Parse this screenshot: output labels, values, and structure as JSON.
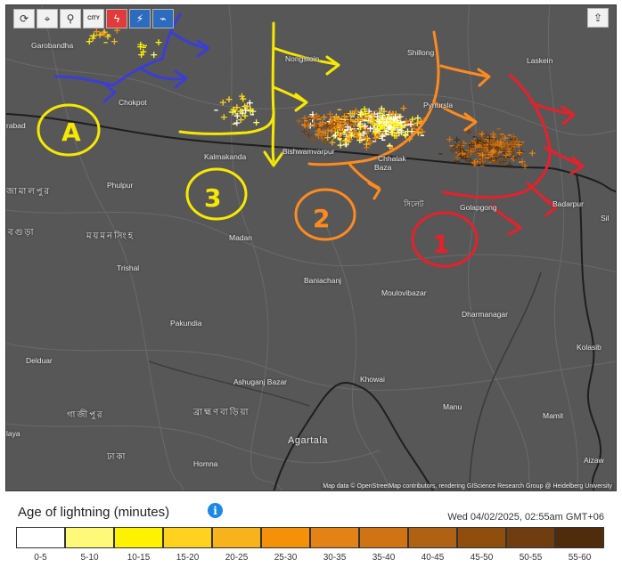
{
  "toolbar": {
    "buttons": [
      {
        "icon": "refresh-icon",
        "glyph": "⟳"
      },
      {
        "icon": "location-pin-icon",
        "glyph": "⌖"
      },
      {
        "icon": "zoom-icon",
        "glyph": "⚲"
      },
      {
        "icon": "city-icon",
        "glyph": "CITY"
      },
      {
        "icon": "lightning-icon",
        "glyph": "ϟ"
      },
      {
        "icon": "strike-icon",
        "glyph": "⚡"
      },
      {
        "icon": "signal-icon",
        "glyph": "⌁"
      }
    ],
    "share_glyph": "⇪"
  },
  "places": [
    {
      "name": "Garobandha"
    },
    {
      "name": "Chokpot"
    },
    {
      "name": "Nongstoin"
    },
    {
      "name": "Shillong"
    },
    {
      "name": "Laskein"
    },
    {
      "name": "Pynursla"
    },
    {
      "name": "rabad"
    },
    {
      "name": "Kalmakanda"
    },
    {
      "name": "Bishwamvarpur"
    },
    {
      "name": "Chhatak"
    },
    {
      "name": "Baza"
    },
    {
      "name": "Phulpur"
    },
    {
      "name": "সিলেট"
    },
    {
      "name": "Golapgong"
    },
    {
      "name": "Badarpur"
    },
    {
      "name": "Sil"
    },
    {
      "name": "জামালপুর"
    },
    {
      "name": "বগুড়া"
    },
    {
      "name": "ময়মনসিংহ"
    },
    {
      "name": "Madan"
    },
    {
      "name": "Trishal"
    },
    {
      "name": "Baniachanj"
    },
    {
      "name": "Moulovibazar"
    },
    {
      "name": "Dharmanagar"
    },
    {
      "name": "Pakundia"
    },
    {
      "name": "Kolasib"
    },
    {
      "name": "Delduar"
    },
    {
      "name": "Khowai"
    },
    {
      "name": "Ashuganj Bazar"
    },
    {
      "name": "Manu"
    },
    {
      "name": "Mamit"
    },
    {
      "name": "গাজীপুর"
    },
    {
      "name": "ব্রাহ্মণবাড়িয়া"
    },
    {
      "name": "Agartala"
    },
    {
      "name": "laya"
    },
    {
      "name": "ঢাকা"
    },
    {
      "name": "Homna"
    },
    {
      "name": "Aizaw"
    }
  ],
  "annotations": [
    {
      "label": "A",
      "color": "#f7e800"
    },
    {
      "label": "3",
      "color": "#f7e800"
    },
    {
      "label": "2",
      "color": "#ff8a1f"
    },
    {
      "label": "1",
      "color": "#e8202a"
    }
  ],
  "attribution": "Map data © OpenStreetMap contributors, rendering GIScience Research Group @ Heidelberg University",
  "legend": {
    "title": "Age of lightning (minutes)",
    "timestamp": "Wed 04/02/2025, 02:55am GMT+06",
    "bins": [
      {
        "label": "0-5",
        "color": "#ffffff"
      },
      {
        "label": "5-10",
        "color": "#fff97a"
      },
      {
        "label": "10-15",
        "color": "#fff200"
      },
      {
        "label": "15-20",
        "color": "#ffd21f"
      },
      {
        "label": "20-25",
        "color": "#f8b21c"
      },
      {
        "label": "25-30",
        "color": "#f59009"
      },
      {
        "label": "30-35",
        "color": "#e58215"
      },
      {
        "label": "35-40",
        "color": "#cf7315"
      },
      {
        "label": "40-45",
        "color": "#b06214"
      },
      {
        "label": "45-50",
        "color": "#8f4e0e"
      },
      {
        "label": "50-55",
        "color": "#6f3d0f"
      },
      {
        "label": "55-60",
        "color": "#4e2c0c"
      }
    ]
  }
}
